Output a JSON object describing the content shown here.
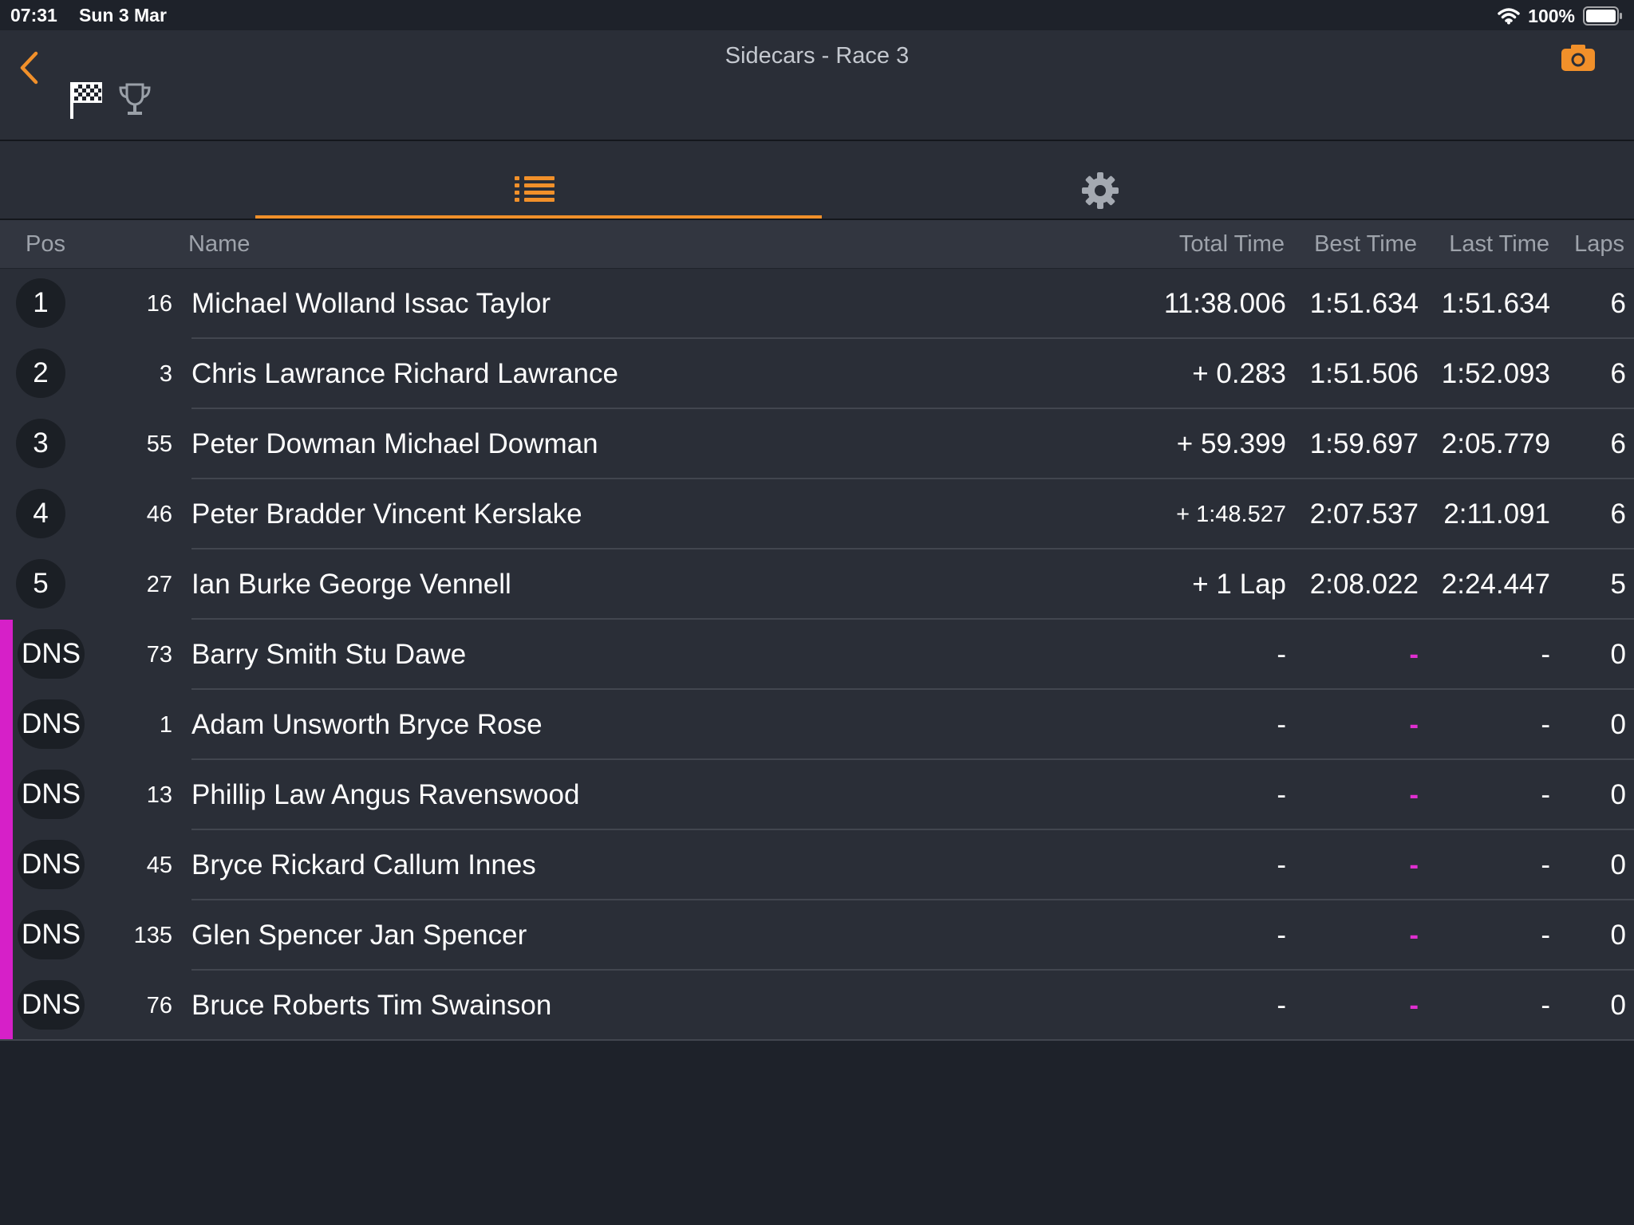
{
  "status_bar": {
    "time": "07:31",
    "date": "Sun 3 Mar",
    "battery": "100%"
  },
  "header": {
    "title": "Sidecars - Race 3"
  },
  "table": {
    "columns": {
      "pos": "Pos",
      "name": "Name",
      "total": "Total Time",
      "best": "Best Time",
      "last": "Last Time",
      "laps": "Laps"
    },
    "rows": [
      {
        "pos": "1",
        "number": "16",
        "name": "Michael Wolland Issac Taylor",
        "total": "11:38.006",
        "best": "1:51.634",
        "last": "1:51.634",
        "laps": "6"
      },
      {
        "pos": "2",
        "number": "3",
        "name": "Chris Lawrance Richard Lawrance",
        "total": "+ 0.283",
        "best": "1:51.506",
        "last": "1:52.093",
        "laps": "6"
      },
      {
        "pos": "3",
        "number": "55",
        "name": "Peter Dowman Michael Dowman",
        "total": "+ 59.399",
        "best": "1:59.697",
        "last": "2:05.779",
        "laps": "6"
      },
      {
        "pos": "4",
        "number": "46",
        "name": "Peter Bradder Vincent Kerslake",
        "total": "+ 1:48.527",
        "best": "2:07.537",
        "last": "2:11.091",
        "laps": "6"
      },
      {
        "pos": "5",
        "number": "27",
        "name": "Ian Burke George Vennell",
        "total": "+ 1 Lap",
        "best": "2:08.022",
        "last": "2:24.447",
        "laps": "5"
      },
      {
        "pos": "DNS",
        "number": "73",
        "name": "Barry Smith Stu Dawe",
        "total": "-",
        "best": "-",
        "last": "-",
        "laps": "0"
      },
      {
        "pos": "DNS",
        "number": "1",
        "name": "Adam Unsworth Bryce Rose",
        "total": "-",
        "best": "-",
        "last": "-",
        "laps": "0"
      },
      {
        "pos": "DNS",
        "number": "13",
        "name": "Phillip Law Angus Ravenswood",
        "total": "-",
        "best": "-",
        "last": "-",
        "laps": "0"
      },
      {
        "pos": "DNS",
        "number": "45",
        "name": "Bryce Rickard Callum Innes",
        "total": "-",
        "best": "-",
        "last": "-",
        "laps": "0"
      },
      {
        "pos": "DNS",
        "number": "135",
        "name": "Glen Spencer Jan Spencer",
        "total": "-",
        "best": "-",
        "last": "-",
        "laps": "0"
      },
      {
        "pos": "DNS",
        "number": "76",
        "name": "Bruce Roberts Tim Swainson",
        "total": "-",
        "best": "-",
        "last": "-",
        "laps": "0"
      }
    ]
  },
  "colors": {
    "accent": "#f1902a",
    "dns_marker": "#d620c8",
    "best_dash": "#e02fd0",
    "background": "#1e222a",
    "row_bg": "#2a2e37"
  },
  "icons": {
    "back": "chevron-left-icon",
    "flag": "checkered-flag-icon",
    "trophy": "trophy-icon",
    "camera": "camera-icon",
    "list": "list-icon",
    "settings": "gear-icon",
    "wifi": "wifi-icon",
    "battery": "battery-icon"
  }
}
